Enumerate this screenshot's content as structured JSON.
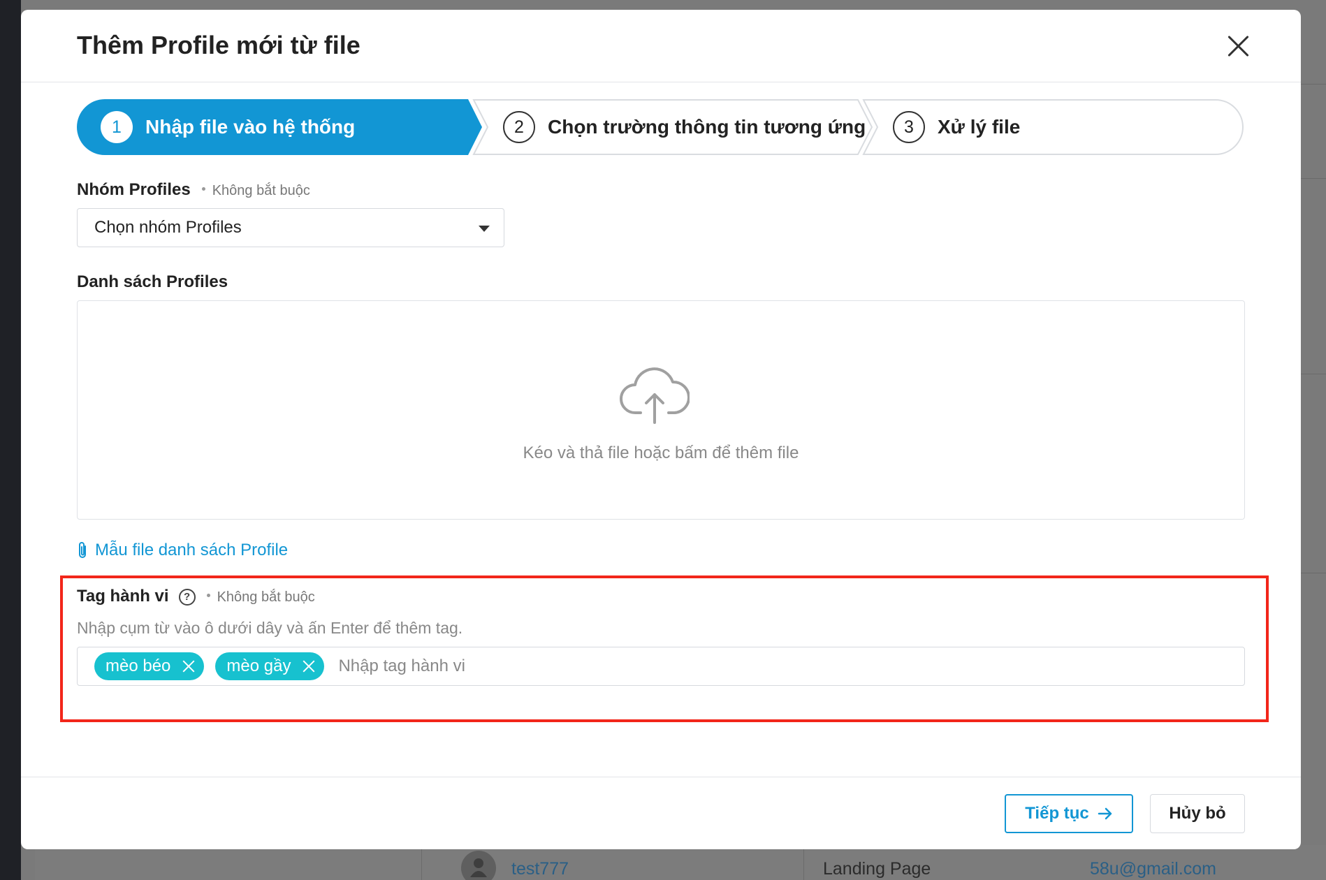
{
  "background": {
    "row": {
      "username": "test777",
      "source": "Landing Page",
      "email": "58u@gmail.com"
    }
  },
  "modal": {
    "title": "Thêm Profile mới từ file",
    "steps": [
      {
        "number": "1",
        "label": "Nhập file vào hệ thống",
        "active": true
      },
      {
        "number": "2",
        "label": "Chọn trường thông tin tương ứng",
        "active": false
      },
      {
        "number": "3",
        "label": "Xử lý file",
        "active": false
      }
    ],
    "group": {
      "label": "Nhóm Profiles",
      "optional": "Không bắt buộc",
      "selected": "Chọn nhóm Profiles"
    },
    "list": {
      "label": "Danh sách Profiles",
      "dropzone_text": "Kéo và thả file hoặc bấm để thêm file"
    },
    "template_link": "Mẫu file danh sách Profile",
    "behavior_tags": {
      "label": "Tag hành vi",
      "optional": "Không bắt buộc",
      "help_icon": "?",
      "hint": "Nhập cụm từ vào ô dưới dây và ấn Enter để thêm tag.",
      "tags": [
        "mèo béo",
        "mèo gầy"
      ],
      "placeholder": "Nhập tag hành vi",
      "value": ""
    },
    "footer": {
      "continue_label": "Tiếp tục",
      "cancel_label": "Hủy bỏ"
    },
    "colors": {
      "primary": "#1296d4",
      "tag": "#17c1cf",
      "highlight": "#f2261a"
    }
  }
}
